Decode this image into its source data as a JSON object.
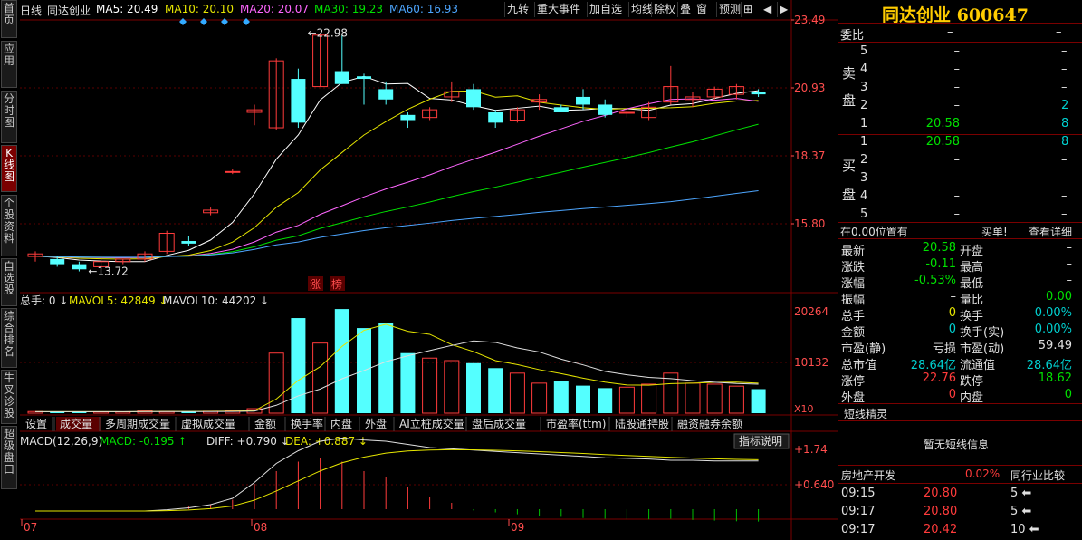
{
  "leftnav": [
    {
      "label": "首页",
      "active": false
    },
    {
      "label": "应用",
      "active": false
    },
    {
      "label": "分时图",
      "active": false
    },
    {
      "label": "K线图",
      "active": true
    },
    {
      "label": "个股资料",
      "active": false
    },
    {
      "label": "自选股",
      "active": false
    },
    {
      "label": "综合排名",
      "active": false
    },
    {
      "label": "牛叉诊股",
      "active": false
    },
    {
      "label": "超级盘口",
      "active": false
    }
  ],
  "topbar": {
    "period": "日线",
    "name": "同达创业",
    "ma5": "MA5: 20.49",
    "ma10": "MA10: 20.10",
    "ma20": "MA20: 20.07",
    "ma30": "MA30: 19.23",
    "ma60": "MA60: 16.93",
    "buttons": [
      "九转",
      "重大事件",
      "加自选",
      "均线",
      "除权",
      "叠",
      "窗",
      "预测"
    ],
    "colors": {
      "ma5": "#ffffff",
      "ma10": "#e6e600",
      "ma20": "#ff66ff",
      "ma30": "#00e000",
      "ma60": "#4da6ff"
    }
  },
  "main_axis": [
    "23.49",
    "20.93",
    "18.37",
    "15.80"
  ],
  "annotations": {
    "high": "22.98",
    "low": "13.72",
    "zhang": "涨",
    "bang": "榜"
  },
  "volume": {
    "label": "总手: 0",
    "mavol5": "MAVOL5: 42849",
    "mavol10": "MAVOL10: 44202",
    "axis": [
      "20264",
      "10132"
    ],
    "unit": "X10"
  },
  "tabs": [
    "设置",
    "成交量",
    "多周期成交量",
    "虚拟成交量",
    "金额",
    "换手率",
    "内盘",
    "外盘",
    "AI立桩成交量",
    "盘后成交量",
    "市盈率(ttm)",
    "陆股通持股",
    "融资融券余额"
  ],
  "macd": {
    "label": "MACD(12,26,9)",
    "macd": "MACD: -0.195",
    "diff": "DIFF: +0.790",
    "dea": "DEA: +0.887",
    "explain": "指标说明",
    "axis": [
      "+1.74",
      "+0.640"
    ]
  },
  "dates": [
    "07",
    "08",
    "09"
  ],
  "chart_data": {
    "type": "candlestick",
    "ohlc": [
      [
        14.3,
        14.5,
        14.1,
        14.4
      ],
      [
        14.2,
        14.3,
        13.9,
        14.0
      ],
      [
        14.0,
        14.1,
        13.72,
        13.8
      ],
      [
        13.9,
        14.3,
        13.8,
        14.1
      ],
      [
        14.1,
        14.2,
        14.0,
        14.2
      ],
      [
        14.2,
        14.5,
        14.1,
        14.4
      ],
      [
        14.5,
        15.3,
        14.4,
        15.2
      ],
      [
        14.9,
        15.1,
        14.7,
        14.8
      ],
      [
        16.0,
        16.2,
        15.9,
        16.1
      ],
      [
        17.6,
        17.7,
        17.5,
        17.6
      ],
      [
        19.9,
        20.2,
        19.4,
        20.0
      ],
      [
        19.3,
        22.0,
        19.2,
        21.9
      ],
      [
        21.2,
        21.6,
        19.3,
        19.5
      ],
      [
        20.9,
        22.98,
        20.9,
        22.9
      ],
      [
        21.5,
        22.9,
        21.0,
        21.0
      ],
      [
        21.3,
        21.4,
        20.2,
        21.2
      ],
      [
        20.8,
        21.1,
        20.2,
        20.4
      ],
      [
        19.8,
        19.9,
        19.3,
        19.6
      ],
      [
        19.7,
        20.1,
        19.6,
        20.0
      ],
      [
        20.5,
        21.1,
        20.3,
        20.7
      ],
      [
        20.8,
        21.0,
        20.0,
        20.1
      ],
      [
        19.9,
        20.0,
        19.3,
        19.5
      ],
      [
        19.6,
        20.1,
        19.5,
        20.0
      ],
      [
        20.3,
        20.6,
        20.0,
        20.4
      ],
      [
        20.1,
        20.2,
        19.9,
        19.9
      ],
      [
        20.5,
        20.8,
        20.0,
        20.2
      ],
      [
        20.2,
        20.4,
        19.7,
        19.8
      ],
      [
        19.9,
        20.0,
        19.7,
        19.9
      ],
      [
        19.7,
        20.3,
        19.6,
        20.1
      ],
      [
        20.3,
        21.7,
        20.2,
        20.9
      ],
      [
        20.4,
        20.7,
        20.1,
        20.5
      ],
      [
        20.5,
        20.9,
        20.4,
        20.8
      ],
      [
        20.6,
        21.0,
        20.4,
        20.9
      ],
      [
        20.7,
        20.8,
        20.5,
        20.6
      ]
    ],
    "volumes": [
      320,
      250,
      300,
      260,
      280,
      520,
      310,
      330,
      380,
      520,
      900,
      12000,
      19000,
      14000,
      20800,
      17000,
      18000,
      12000,
      11000,
      10500,
      10000,
      9000,
      8000,
      6000,
      6500,
      5500,
      5000,
      5200,
      5800,
      8000,
      6000,
      5800,
      5400,
      4800
    ],
    "macd_bars": [
      0,
      0,
      0,
      0,
      0,
      0,
      0,
      0.05,
      0.08,
      0.15,
      0.4,
      0.6,
      0.75,
      0.8,
      0.75,
      0.6,
      0.5,
      0.35,
      0.2,
      0.1,
      -0.02,
      -0.05,
      -0.08,
      -0.1,
      -0.12,
      -0.14,
      -0.15,
      -0.16,
      -0.16,
      -0.15,
      -0.17,
      -0.18,
      -0.19,
      -0.195
    ],
    "ylim": [
      13.0,
      23.49
    ]
  },
  "right": {
    "title": "同达创业 600647",
    "weibi": "委比",
    "weibi_val": "–",
    "weibi_val2": "–",
    "sell_label": "卖盘",
    "buy_label": "买盘",
    "sell": [
      [
        "5",
        "–",
        "–"
      ],
      [
        "4",
        "–",
        "–"
      ],
      [
        "3",
        "–",
        "–"
      ],
      [
        "2",
        "–",
        "2"
      ],
      [
        "1",
        "20.58",
        "8"
      ]
    ],
    "buy": [
      [
        "1",
        "20.58",
        "8"
      ],
      [
        "2",
        "–",
        "–"
      ],
      [
        "3",
        "–",
        "–"
      ],
      [
        "4",
        "–",
        "–"
      ],
      [
        "5",
        "–",
        "–"
      ]
    ],
    "pos_line": "在0.00位置有",
    "buy_single": "买单!",
    "check": "查看详细",
    "quotes": [
      {
        "l": "最新",
        "v": "20.58",
        "vc": "green",
        "l2": "开盘",
        "v2": "–",
        "v2c": "white"
      },
      {
        "l": "涨跌",
        "v": "-0.11",
        "vc": "green",
        "l2": "最高",
        "v2": "–",
        "v2c": "white"
      },
      {
        "l": "涨幅",
        "v": "-0.53%",
        "vc": "green",
        "l2": "最低",
        "v2": "–",
        "v2c": "white"
      },
      {
        "l": "振幅",
        "v": "–",
        "vc": "white",
        "l2": "量比",
        "v2": "0.00",
        "v2c": "green"
      },
      {
        "l": "总手",
        "v": "0",
        "vc": "yellow",
        "l2": "换手",
        "v2": "0.00%",
        "v2c": "cyan"
      },
      {
        "l": "金额",
        "v": "0",
        "vc": "cyan",
        "l2": "换手(实)",
        "v2": "0.00%",
        "v2c": "cyan"
      },
      {
        "l": "市盈(静)",
        "v": "亏损",
        "vc": "white",
        "l2": "市盈(动)",
        "v2": "59.49",
        "v2c": "white"
      },
      {
        "l": "总市值",
        "v": "28.64亿",
        "vc": "cyan",
        "l2": "流通值",
        "v2": "28.64亿",
        "v2c": "cyan"
      },
      {
        "l": "涨停",
        "v": "22.76",
        "vc": "red",
        "l2": "跌停",
        "v2": "18.62",
        "v2c": "green"
      },
      {
        "l": "外盘",
        "v": "0",
        "vc": "red",
        "l2": "内盘",
        "v2": "0",
        "v2c": "green"
      }
    ],
    "short_title": "短线精灵",
    "short_empty": "暂无短线信息",
    "industry": "房地产开发",
    "industry_pct": "0.02%",
    "industry_cmp": "同行业比较",
    "ticks": [
      {
        "t": "09:15",
        "p": "20.80",
        "v": "5"
      },
      {
        "t": "09:17",
        "p": "20.80",
        "v": "5"
      },
      {
        "t": "09:17",
        "p": "20.42",
        "v": "10"
      }
    ]
  }
}
